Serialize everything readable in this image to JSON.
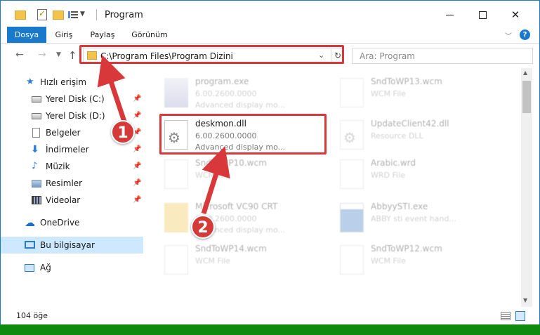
{
  "window": {
    "title": "Program",
    "controls": {
      "minimize": "",
      "maximize": "",
      "close": "✕"
    }
  },
  "ribbon": {
    "tabs": [
      "Dosya",
      "Giriş",
      "Paylaş",
      "Görünüm"
    ],
    "help_label": "?"
  },
  "navigation": {
    "address": "C:\\Program Files\\Program Dizini",
    "search_placeholder": "Ara: Program"
  },
  "sidebar": {
    "items": [
      {
        "label": "Hızlı erişim",
        "icon": "star-icon",
        "pinned": false
      },
      {
        "label": "Yerel Disk (C:)",
        "icon": "disk-icon",
        "pinned": true
      },
      {
        "label": "Yerel Disk (D:)",
        "icon": "disk-icon",
        "pinned": true
      },
      {
        "label": "Belgeler",
        "icon": "documents-icon",
        "pinned": true
      },
      {
        "label": "İndirmeler",
        "icon": "downloads-icon",
        "pinned": true
      },
      {
        "label": "Müzik",
        "icon": "music-icon",
        "pinned": true
      },
      {
        "label": "Resimler",
        "icon": "pictures-icon",
        "pinned": true
      },
      {
        "label": "Videolar",
        "icon": "videos-icon",
        "pinned": true
      },
      {
        "label": "OneDrive",
        "icon": "onedrive-icon",
        "pinned": false
      },
      {
        "label": "Bu bilgisayar",
        "icon": "this-pc-icon",
        "pinned": false,
        "selected": true
      },
      {
        "label": "Ağ",
        "icon": "network-icon",
        "pinned": false
      }
    ]
  },
  "files": [
    {
      "name": "program.exe",
      "sub1": "6.00.2600.0000",
      "sub2": "Advanced display mo...",
      "icon": "exe-icon",
      "faded": true
    },
    {
      "name": "SndToWP13.wcm",
      "sub1": "WCM File",
      "sub2": "",
      "icon": "file-icon",
      "faded": true
    },
    {
      "name": "deskmon.dll",
      "sub1": "6.00.2600.0000",
      "sub2": "Advanced display mo...",
      "icon": "gear-file-icon",
      "faded": false
    },
    {
      "name": "UpdateClient42.dll",
      "sub1": "Resource DLL",
      "sub2": "",
      "icon": "gear-file-icon",
      "faded": true
    },
    {
      "name": "SndToWP10.wcm",
      "sub1": "WCM File",
      "sub2": "",
      "icon": "file-icon",
      "faded": true
    },
    {
      "name": "Arabic.wrd",
      "sub1": "WRD File",
      "sub2": "",
      "icon": "file-icon",
      "faded": true
    },
    {
      "name": "Microsoft VC90 CRT",
      "sub1": "6.00.2600.0000",
      "sub2": "Advanced display mo...",
      "icon": "folder-icon",
      "faded": true
    },
    {
      "name": "AbbyySTI.exe",
      "sub1": "ABBY sti event hand...",
      "sub2": "",
      "icon": "app-icon",
      "faded": true
    },
    {
      "name": "SndToWP14.wcm",
      "sub1": "WCM File",
      "sub2": "",
      "icon": "file-icon",
      "faded": true
    },
    {
      "name": "SndToWP12.wcm",
      "sub1": "WCM File",
      "sub2": "",
      "icon": "file-icon",
      "faded": true
    }
  ],
  "status": {
    "item_count": "104 öğe"
  },
  "callouts": [
    "1",
    "2"
  ],
  "colors": {
    "accent": "#1979ca",
    "highlight": "#d9383a",
    "selected_bg": "#cde8ff"
  }
}
